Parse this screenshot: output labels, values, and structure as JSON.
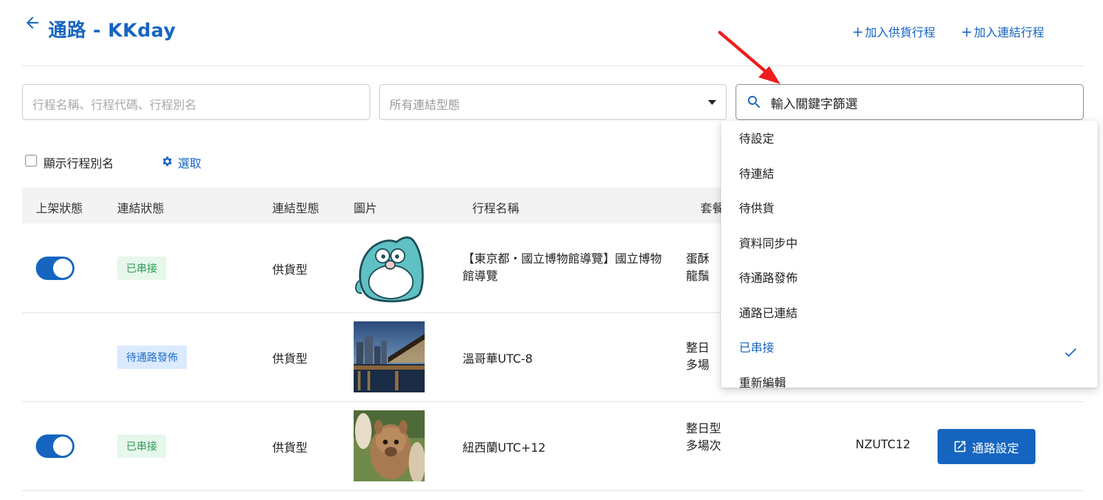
{
  "header": {
    "title": "通路  - KKday",
    "add_supply_label": "加入供貨行程",
    "add_link_label": "加入連結行程"
  },
  "filters": {
    "name_placeholder": "行程名稱、行程代碼、行程別名",
    "link_type_placeholder": "所有連結型態",
    "keyword_value": "輸入關鍵字篩選"
  },
  "options": {
    "show_alias_label": "顯示行程別名",
    "select_label": "選取"
  },
  "table": {
    "headers": [
      "上架狀態",
      "連結狀態",
      "連結型態",
      "圖片",
      "行程名稱",
      "套餐"
    ],
    "rows": [
      {
        "listed": true,
        "status": "已串接",
        "status_color": "green",
        "link_type": "供貨型",
        "image": "penguin-sticker",
        "name_line1": "【東京都・國立博物館導覽】國立博物",
        "name_line2": "館導覽",
        "package_line1": "蛋酥",
        "package_line2": "龍鬚",
        "code": "",
        "action": ""
      },
      {
        "listed": false,
        "status": "待通路發佈",
        "status_color": "blue",
        "link_type": "供貨型",
        "image": "city-night-bridge",
        "name_line1": "溫哥華UTC-8",
        "name_line2": "",
        "package_line1": "整日",
        "package_line2": "多場",
        "code": "",
        "action": ""
      },
      {
        "listed": true,
        "status": "已串接",
        "status_color": "green",
        "link_type": "供貨型",
        "image": "alpaca",
        "name_line1": "紐西蘭UTC+12",
        "name_line2": "",
        "package_line1": "整日型",
        "package_line2": "多場次",
        "code": "NZUTC12",
        "action": "通路設定"
      }
    ]
  },
  "dropdown": {
    "items": [
      "待設定",
      "待連結",
      "待供貨",
      "資料同步中",
      "待通路發佈",
      "通路已連結",
      "已串接",
      "重新編輯"
    ],
    "selected": "已串接"
  },
  "colors": {
    "primary": "#1565c0",
    "badge_green_bg": "#e6f7ec",
    "badge_green_text": "#2e9b54",
    "badge_blue_bg": "#dbeafd",
    "badge_blue_text": "#1e6ec8",
    "annotation_arrow": "#f01c1c"
  }
}
